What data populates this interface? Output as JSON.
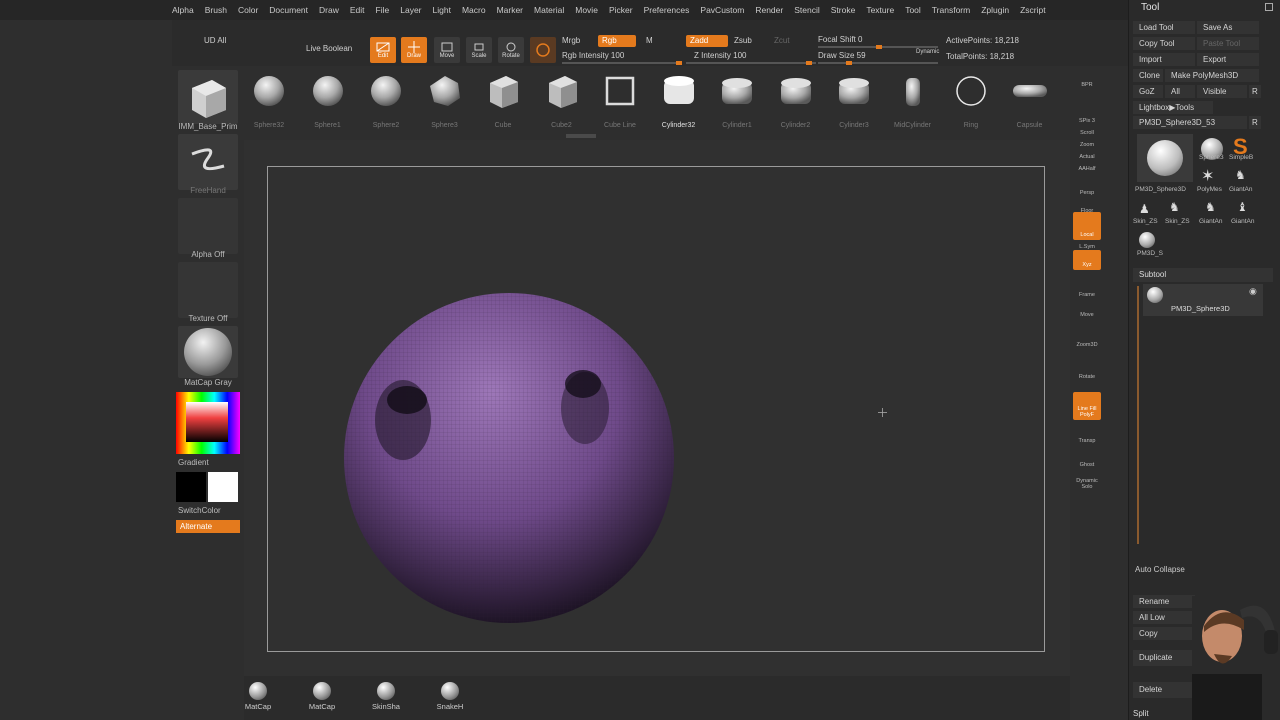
{
  "menu": [
    "Alpha",
    "Brush",
    "Color",
    "Document",
    "Draw",
    "Edit",
    "File",
    "Layer",
    "Light",
    "Macro",
    "Marker",
    "Material",
    "Movie",
    "Picker",
    "Preferences",
    "PavCustom",
    "Render",
    "Stencil",
    "Stroke",
    "Texture",
    "Tool",
    "Transform",
    "Zplugin",
    "Zscript"
  ],
  "shelf": {
    "ud_all": "UD All",
    "live_boolean": "Live Boolean",
    "edit": "Edit",
    "draw": "Draw",
    "move": "Move",
    "scale": "Scale",
    "rotate": "Rotate",
    "mrgb": "Mrgb",
    "rgb": "Rgb",
    "m": "M",
    "rgb_intensity": "Rgb Intensity 100",
    "zadd": "Zadd",
    "zsub": "Zsub",
    "zcut": "Zcut",
    "z_intensity": "Z Intensity 100",
    "focal_shift": "Focal Shift 0",
    "draw_size": "Draw Size 59",
    "dynamic": "Dynamic",
    "active_points": "ActivePoints: 18,218",
    "total_points": "TotalPoints: 18,218"
  },
  "left": {
    "brush_label": "IMM_Base_Prim",
    "stroke_label": "FreeHand",
    "alpha_label": "Alpha Off",
    "texture_label": "Texture Off",
    "material_label": "MatCap Gray",
    "gradient_label": "Gradient",
    "switch_color": "SwitchColor",
    "alternate": "Alternate"
  },
  "brushes": [
    {
      "label": "Sphere32"
    },
    {
      "label": "Sphere1"
    },
    {
      "label": "Sphere2"
    },
    {
      "label": "Sphere3"
    },
    {
      "label": "Cube"
    },
    {
      "label": "Cube2"
    },
    {
      "label": "Cube Line"
    },
    {
      "label": "Cylinder32"
    },
    {
      "label": "Cylinder1"
    },
    {
      "label": "Cylinder2"
    },
    {
      "label": "Cylinder3"
    },
    {
      "label": "MidCylinder"
    },
    {
      "label": "Ring"
    },
    {
      "label": "Capsule"
    }
  ],
  "rightbar": [
    "BPR",
    "SPix 3",
    "Scroll",
    "Zoom",
    "Actual",
    "AAHalf",
    "Persp",
    "Floor",
    "Local",
    "L.Sym",
    "Xyz",
    "Frame",
    "Move",
    "Zoom3D",
    "Rotate",
    "Line Fill PolyF",
    "Transp",
    "Ghost",
    "Dynamic Solo"
  ],
  "tool": {
    "title": "Tool",
    "load_tool": "Load Tool",
    "save_as": "Save As",
    "copy_tool": "Copy Tool",
    "paste_tool": "Paste Tool",
    "import": "Import",
    "export": "Export",
    "clone": "Clone",
    "make_polymesh": "Make PolyMesh3D",
    "goz": "GoZ",
    "all": "All",
    "visible": "Visible",
    "r": "R",
    "lightbox_tools": "Lightbox▶Tools",
    "current_tool": "PM3D_Sphere3D_53",
    "thumb_labels": [
      "PM3D_Sphere3D",
      "Sphere3",
      "SimpleB",
      "PolyMes",
      "GiantAn",
      "Skin_ZS",
      "Skin_ZS",
      "GiantAn",
      "GiantAn",
      "PM3D_S"
    ],
    "subtool": "Subtool",
    "subtool_item": "PM3D_Sphere3D",
    "auto_collapse": "Auto Collapse",
    "rename": "Rename",
    "all_low": "All Low",
    "copy": "Copy",
    "duplicate": "Duplicate",
    "delete": "Delete",
    "split": "Split"
  },
  "matcaps": [
    "MatCap",
    "MatCap",
    "SkinSha",
    "SnakeH"
  ],
  "colors": {
    "accent": "#e47a1d",
    "mesh": "#7a4f96"
  }
}
